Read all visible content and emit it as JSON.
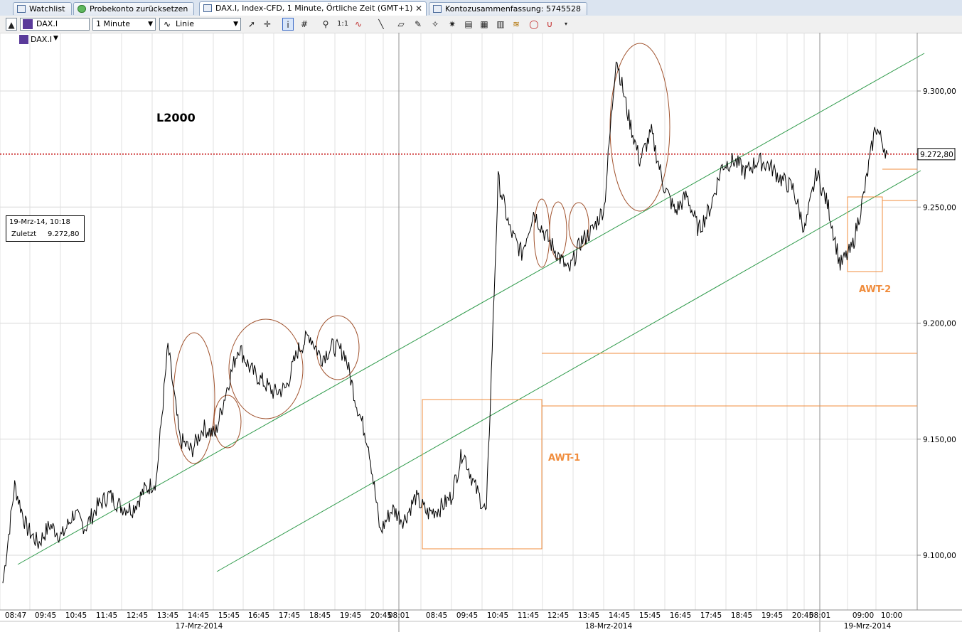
{
  "tabs": [
    {
      "label": "Watchlist"
    },
    {
      "label": "Probekonto zurücksetzen"
    },
    {
      "label": "DAX.I, Index-CFD, 1 Minute, Örtliche Zeit (GMT+1)",
      "close": "✕"
    },
    {
      "label": "Kontozusammenfassung: 5745528"
    }
  ],
  "toolbar": {
    "symbol": "DAX.I",
    "interval": "1 Minute",
    "chart_style": "Linie",
    "icons": [
      "collapse-icon",
      "pointer-icon",
      "crosshair-icon",
      "info-icon",
      "grid-icon",
      "zoom-icon",
      "one-to-one-icon",
      "indicator-icon",
      "line-tool-icon",
      "eraser-icon",
      "pencil-icon",
      "magic-icon",
      "chart-a-icon",
      "chart-b-icon",
      "chart-c-icon",
      "wave-icon",
      "magnet-icon",
      "more-icon"
    ]
  },
  "legend_symbol": "DAX.I",
  "annotations": {
    "l2000": "L2000",
    "awt1": "AWT-1",
    "awt2": "AWT-2"
  },
  "infobox": {
    "date": "19-Mrz-14, 10:18",
    "last_label": "Zuletzt",
    "last_value": "9.272,80"
  },
  "colors": {
    "price_line": "#000000",
    "trend_line": "#2e9a4a",
    "awt": "#f08c3c",
    "circle": "#a0522d",
    "last_price_line": "#c00000"
  },
  "chart_data": {
    "type": "line",
    "ylim": [
      9080,
      9330
    ],
    "price_axis_labels": [
      "9.300,00",
      "9.250,00",
      "9.200,00",
      "9.150,00",
      "9.100,00"
    ],
    "last_price": 9272.8,
    "last_price_label": "9.272,80",
    "time_labels": [
      "08:47",
      "09:45",
      "10:45",
      "11:45",
      "12:45",
      "13:45",
      "14:45",
      "15:45",
      "16:45",
      "17:45",
      "18:45",
      "19:45",
      "20:45",
      "08:01",
      "08:45",
      "09:45",
      "10:45",
      "11:45",
      "12:45",
      "13:45",
      "14:45",
      "15:45",
      "16:45",
      "17:45",
      "18:45",
      "19:45",
      "20:45",
      "08:01",
      "09:00",
      "10:00"
    ],
    "date_labels": [
      "17-Mrz-2014",
      "18-Mrz-2014",
      "19-Mrz-2014"
    ],
    "series": [
      {
        "values": [
          9088,
          9130,
          9112,
          9105,
          9113,
          9108,
          9118,
          9112,
          9121,
          9126,
          9121,
          9120,
          9128,
          9132,
          9190,
          9150,
          9145,
          9155,
          9152,
          9172,
          9190,
          9180,
          9175,
          9170,
          9172,
          9188,
          9195,
          9185,
          9190,
          9187,
          9165,
          9148,
          9110,
          9120,
          9115,
          9125,
          9118,
          9120,
          9125,
          9145,
          9130,
          9118,
          9262,
          9240,
          9230,
          9248,
          9238,
          9230,
          9222,
          9235,
          9240,
          9250,
          9315,
          9290,
          9270,
          9282,
          9260,
          9248,
          9255,
          9240,
          9250,
          9268,
          9270,
          9265,
          9270,
          9268,
          9262,
          9258,
          9240,
          9265,
          9250,
          9225,
          9232,
          9255,
          9285,
          9272.8
        ]
      }
    ]
  }
}
